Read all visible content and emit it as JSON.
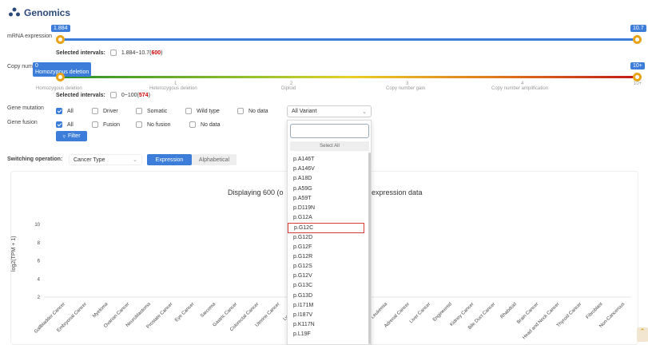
{
  "header": {
    "title": "Genomics"
  },
  "mrna": {
    "label": "mRNA expression",
    "min_tip": "1.884",
    "max_tip": "10.7",
    "sel_label": "Selected intervals:",
    "range": "1.884~10.7",
    "count": "600"
  },
  "copy": {
    "label": "Copy num",
    "tip1": "0",
    "tip2": "Homozygous deletion",
    "max_tip": "10+",
    "sel_label": "Selected intervals:",
    "range": "0~100",
    "count": "574",
    "ticks": [
      "",
      "1",
      "2",
      "3",
      "4",
      "10+"
    ],
    "cats": [
      "Homozygous deletion",
      "Heterozygous deletion",
      "Diploid",
      "Copy number gain",
      "Copy number amplification"
    ]
  },
  "mutation": {
    "label": "Gene mutation",
    "opts": [
      "All",
      "Driver",
      "Somatic",
      "Wild type",
      "No data"
    ],
    "select": "All Variant"
  },
  "fusion": {
    "label": "Gene fusion",
    "opts": [
      "All",
      "Fusion",
      "No fusion",
      "No data"
    ]
  },
  "filter_btn": "Filter",
  "switch": {
    "label": "Switching operation:",
    "select": "Cancer Type",
    "tab1": "Expression",
    "tab2": "Alphabetical"
  },
  "chart_title_a": "Displaying 600 (o",
  "chart_title_b": "expression data",
  "dropdown": {
    "select_all": "Select All",
    "items": [
      "p.A146T",
      "p.A146V",
      "p.A18D",
      "p.A59G",
      "p.A59T",
      "p.D119N",
      "p.G12A",
      "p.G12C",
      "p.G12D",
      "p.G12F",
      "p.G12R",
      "p.G12S",
      "p.G12V",
      "p.G13C",
      "p.G13D",
      "p.I171M",
      "p.I187V",
      "p.K117N",
      "p.L19F"
    ],
    "highlighted": "p.G12C"
  },
  "chart_data": {
    "type": "box",
    "title": "",
    "ylabel": "log2(TPM + 1)",
    "ylim": [
      2,
      10
    ],
    "yticks": [
      2,
      4,
      6,
      8,
      10
    ],
    "categories": [
      "Gallbladder Cancer",
      "Embryonal Cancer",
      "Myeloma",
      "Ovarian Cancer",
      "Neuroblastoma",
      "Prostate Cancer",
      "Eye Cancer",
      "Sarcoma",
      "Gastric Cancer",
      "Colorectal Cancer",
      "Uterine Cancer",
      "Lymphoma",
      "Lung Cancer",
      "Pancreatic Cancer",
      "Bladder Cancer",
      "Leukemia",
      "Adrenal Cancer",
      "Liver Cancer",
      "Engineered",
      "Kidney Cancer",
      "Bile Duct Cancer",
      "Rhabdoid",
      "Brain Cancer",
      "Head and Neck Cancer",
      "Thyroid Cancer",
      "Fibroblast",
      "Non-Cancerous"
    ]
  }
}
